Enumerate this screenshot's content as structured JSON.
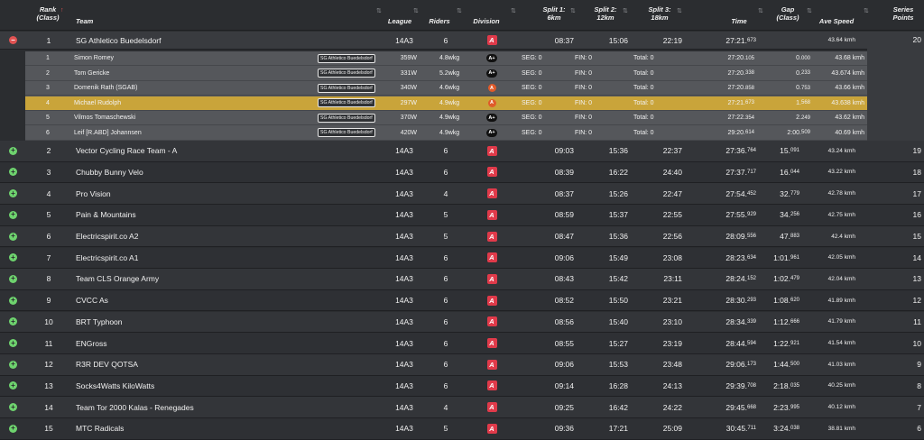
{
  "header": {
    "rank": "Rank",
    "rank_sub": "(Class)",
    "team": "Team",
    "league": "League",
    "riders": "Riders",
    "division": "Division",
    "split1": "Split 1:",
    "split1_sub": "6km",
    "split2": "Split 2:",
    "split2_sub": "12km",
    "split3": "Split 3:",
    "split3_sub": "18km",
    "time": "Time",
    "gap": "Gap",
    "gap_sub": "(Class)",
    "speed": "Ave Speed",
    "series": "Series",
    "series_sub": "Points",
    "sort_glyph": "⇅",
    "sort_active_glyph": "↑"
  },
  "toggle_plus": "+",
  "toggle_minus": "−",
  "division_label": "A",
  "expanded_team": {
    "rank": "1",
    "name": "SG Athletico Buedelsdorf",
    "league": "14A3",
    "riders": "6",
    "split1": "08:37",
    "split2": "15:06",
    "split3": "22:19",
    "time_main": "27:21.",
    "time_ms": "673",
    "gap": "",
    "speed": "43.64 kmh",
    "points": "20"
  },
  "riders": [
    {
      "rank": "1",
      "name": "Simon Romey",
      "tag": "SG Athletico Buedelsdorf",
      "power": "359W",
      "wkg": "4.8wkg",
      "cat": "A+",
      "seg": "SEG: 0",
      "fin": "FIN: 0",
      "total": "Total: 0",
      "time_main": "27:20.",
      "time_ms": "105",
      "gap_main": "0.",
      "gap_ms": "000",
      "speed": "43.68 kmh"
    },
    {
      "rank": "2",
      "name": "Tom Gericke",
      "tag": "SG Athletico Buedelsdorf",
      "power": "331W",
      "wkg": "5.2wkg",
      "cat": "A+",
      "seg": "SEG: 0",
      "fin": "FIN: 0",
      "total": "Total: 0",
      "time_main": "27:20.",
      "time_ms": "338",
      "gap_main": "0.",
      "gap_ms": "233",
      "speed": "43.674 kmh"
    },
    {
      "rank": "3",
      "name": "Domenik Rath (SGAB)",
      "tag": "SG Athletico Buedelsdorf",
      "power": "340W",
      "wkg": "4.6wkg",
      "cat": "A",
      "seg": "SEG: 0",
      "fin": "FIN: 0",
      "total": "Total: 0",
      "time_main": "27:20.",
      "time_ms": "858",
      "gap_main": "0.",
      "gap_ms": "753",
      "speed": "43.66 kmh"
    },
    {
      "rank": "4",
      "name": "Michael Rudolph",
      "tag": "SG Athletico Buedelsdorf",
      "power": "297W",
      "wkg": "4.9wkg",
      "cat": "A",
      "seg": "SEG: 0",
      "fin": "FIN: 0",
      "total": "Total: 0",
      "time_main": "27:21.",
      "time_ms": "673",
      "gap_main": "1.",
      "gap_ms": "568",
      "speed": "43.638 kmh",
      "highlight": true
    },
    {
      "rank": "5",
      "name": "Vilmos Tomaschewski",
      "tag": "SG Athletico Buedelsdorf",
      "power": "370W",
      "wkg": "4.9wkg",
      "cat": "A+",
      "seg": "SEG: 0",
      "fin": "FIN: 0",
      "total": "Total: 0",
      "time_main": "27:22.",
      "time_ms": "354",
      "gap_main": "2.",
      "gap_ms": "249",
      "speed": "43.62 kmh"
    },
    {
      "rank": "6",
      "name": "Leif [R.ABD] Johannsen",
      "tag": "SG Athletico Buedelsdorf",
      "power": "420W",
      "wkg": "4.9wkg",
      "cat": "A+",
      "seg": "SEG: 0",
      "fin": "FIN: 0",
      "total": "Total: 0",
      "time_main": "29:20.",
      "time_ms": "614",
      "gap_main": "2:00.",
      "gap_ms": "509",
      "speed": "40.69 kmh"
    }
  ],
  "teams": [
    {
      "rank": "2",
      "name": "Vector Cycling Race Team - A",
      "league": "14A3",
      "riders": "6",
      "split1": "09:03",
      "split2": "15:36",
      "split3": "22:37",
      "time_main": "27:36.",
      "time_ms": "764",
      "gap_main": "15.",
      "gap_ms": "091",
      "speed": "43.24 kmh",
      "points": "19"
    },
    {
      "rank": "3",
      "name": "Chubby Bunny Velo",
      "league": "14A3",
      "riders": "6",
      "split1": "08:39",
      "split2": "16:22",
      "split3": "24:40",
      "time_main": "27:37.",
      "time_ms": "717",
      "gap_main": "16.",
      "gap_ms": "044",
      "speed": "43.22 kmh",
      "points": "18"
    },
    {
      "rank": "4",
      "name": "Pro Vision",
      "league": "14A3",
      "riders": "4",
      "split1": "08:37",
      "split2": "15:26",
      "split3": "22:47",
      "time_main": "27:54.",
      "time_ms": "452",
      "gap_main": "32.",
      "gap_ms": "779",
      "speed": "42.78 kmh",
      "points": "17"
    },
    {
      "rank": "5",
      "name": "Pain & Mountains",
      "league": "14A3",
      "riders": "5",
      "split1": "08:59",
      "split2": "15:37",
      "split3": "22:55",
      "time_main": "27:55.",
      "time_ms": "929",
      "gap_main": "34.",
      "gap_ms": "256",
      "speed": "42.75 kmh",
      "points": "16"
    },
    {
      "rank": "6",
      "name": "Electricspirit.co A2",
      "league": "14A3",
      "riders": "5",
      "split1": "08:47",
      "split2": "15:36",
      "split3": "22:56",
      "time_main": "28:09.",
      "time_ms": "556",
      "gap_main": "47.",
      "gap_ms": "883",
      "speed": "42.4 kmh",
      "points": "15"
    },
    {
      "rank": "7",
      "name": "Electricspirit.co A1",
      "league": "14A3",
      "riders": "6",
      "split1": "09:06",
      "split2": "15:49",
      "split3": "23:08",
      "time_main": "28:23.",
      "time_ms": "634",
      "gap_main": "1:01.",
      "gap_ms": "961",
      "speed": "42.05 kmh",
      "points": "14"
    },
    {
      "rank": "8",
      "name": "Team CLS Orange Army",
      "league": "14A3",
      "riders": "6",
      "split1": "08:43",
      "split2": "15:42",
      "split3": "23:11",
      "time_main": "28:24.",
      "time_ms": "152",
      "gap_main": "1:02.",
      "gap_ms": "479",
      "speed": "42.04 kmh",
      "points": "13"
    },
    {
      "rank": "9",
      "name": "CVCC As",
      "league": "14A3",
      "riders": "6",
      "split1": "08:52",
      "split2": "15:50",
      "split3": "23:21",
      "time_main": "28:30.",
      "time_ms": "293",
      "gap_main": "1:08.",
      "gap_ms": "620",
      "speed": "41.89 kmh",
      "points": "12"
    },
    {
      "rank": "10",
      "name": "BRT Typhoon",
      "league": "14A3",
      "riders": "6",
      "split1": "08:56",
      "split2": "15:40",
      "split3": "23:10",
      "time_main": "28:34.",
      "time_ms": "339",
      "gap_main": "1:12.",
      "gap_ms": "666",
      "speed": "41.79 kmh",
      "points": "11"
    },
    {
      "rank": "11",
      "name": "ENGross",
      "league": "14A3",
      "riders": "6",
      "split1": "08:55",
      "split2": "15:27",
      "split3": "23:19",
      "time_main": "28:44.",
      "time_ms": "594",
      "gap_main": "1:22.",
      "gap_ms": "921",
      "speed": "41.54 kmh",
      "points": "10"
    },
    {
      "rank": "12",
      "name": "R3R DEV QOTSA",
      "league": "14A3",
      "riders": "6",
      "split1": "09:06",
      "split2": "15:53",
      "split3": "23:48",
      "time_main": "29:06.",
      "time_ms": "173",
      "gap_main": "1:44.",
      "gap_ms": "500",
      "speed": "41.03 kmh",
      "points": "9"
    },
    {
      "rank": "13",
      "name": "Socks4Watts KiloWatts",
      "league": "14A3",
      "riders": "6",
      "split1": "09:14",
      "split2": "16:28",
      "split3": "24:13",
      "time_main": "29:39.",
      "time_ms": "708",
      "gap_main": "2:18.",
      "gap_ms": "035",
      "speed": "40.25 kmh",
      "points": "8"
    },
    {
      "rank": "14",
      "name": "Team Tor 2000 Kalas - Renegades",
      "league": "14A3",
      "riders": "4",
      "split1": "09:25",
      "split2": "16:42",
      "split3": "24:22",
      "time_main": "29:45.",
      "time_ms": "668",
      "gap_main": "2:23.",
      "gap_ms": "995",
      "speed": "40.12 kmh",
      "points": "7"
    },
    {
      "rank": "15",
      "name": "MTC Radicals",
      "league": "14A3",
      "riders": "5",
      "split1": "09:36",
      "split2": "17:21",
      "split3": "25:09",
      "time_main": "30:45.",
      "time_ms": "711",
      "gap_main": "3:24.",
      "gap_ms": "038",
      "speed": "38.81 kmh",
      "points": "6"
    }
  ],
  "colors": {
    "background": "#2b2d30",
    "highlight": "#c9a43a",
    "division_badge": "#e03a4a",
    "expand_toggle": "#6ed36e",
    "collapse_toggle": "#e05252"
  }
}
